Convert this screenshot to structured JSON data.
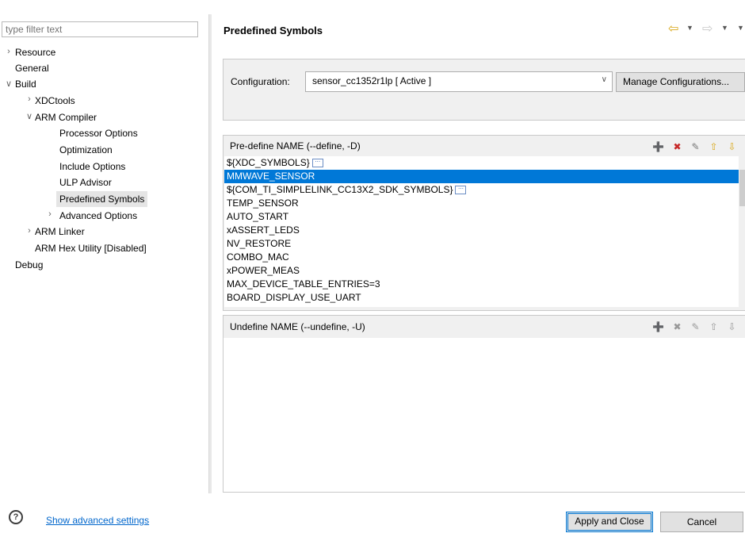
{
  "filter": {
    "placeholder": "type filter text"
  },
  "tree": {
    "resource": "Resource",
    "general": "General",
    "build": "Build",
    "xdctools": "XDCtools",
    "arm_compiler": "ARM Compiler",
    "processor_options": "Processor Options",
    "optimization": "Optimization",
    "include_options": "Include Options",
    "ulp_advisor": "ULP Advisor",
    "predefined_symbols": "Predefined Symbols",
    "advanced_options": "Advanced Options",
    "arm_linker": "ARM Linker",
    "arm_hex_utility": "ARM Hex Utility  [Disabled]",
    "debug": "Debug"
  },
  "page": {
    "title": "Predefined Symbols"
  },
  "config": {
    "label": "Configuration:",
    "value": "sensor_cc1352r1lp  [ Active ]",
    "manage_button": "Manage Configurations..."
  },
  "predefine": {
    "title": "Pre-define NAME (--define, -D)",
    "symbols": [
      "${XDC_SYMBOLS}",
      "MMWAVE_SENSOR",
      "${COM_TI_SIMPLELINK_CC13X2_SDK_SYMBOLS}",
      "TEMP_SENSOR",
      "AUTO_START",
      "xASSERT_LEDS",
      "NV_RESTORE",
      "COMBO_MAC",
      "xPOWER_MEAS",
      "MAX_DEVICE_TABLE_ENTRIES=3",
      "BOARD_DISPLAY_USE_UART"
    ],
    "selected_index": 1
  },
  "undefine": {
    "title": "Undefine NAME (--undefine, -U)"
  },
  "footer": {
    "advanced_link": "Show advanced settings",
    "apply_button": "Apply and Close",
    "cancel_button": "Cancel"
  },
  "icons": {
    "help": "help-icon",
    "nav_back": "back-arrow-icon",
    "nav_forward": "forward-arrow-icon",
    "ellipsis": "ellipsis-icon"
  },
  "colors": {
    "selection": "#0078d7",
    "link": "#0066cc",
    "nav_arrow": "#d9a81a"
  }
}
